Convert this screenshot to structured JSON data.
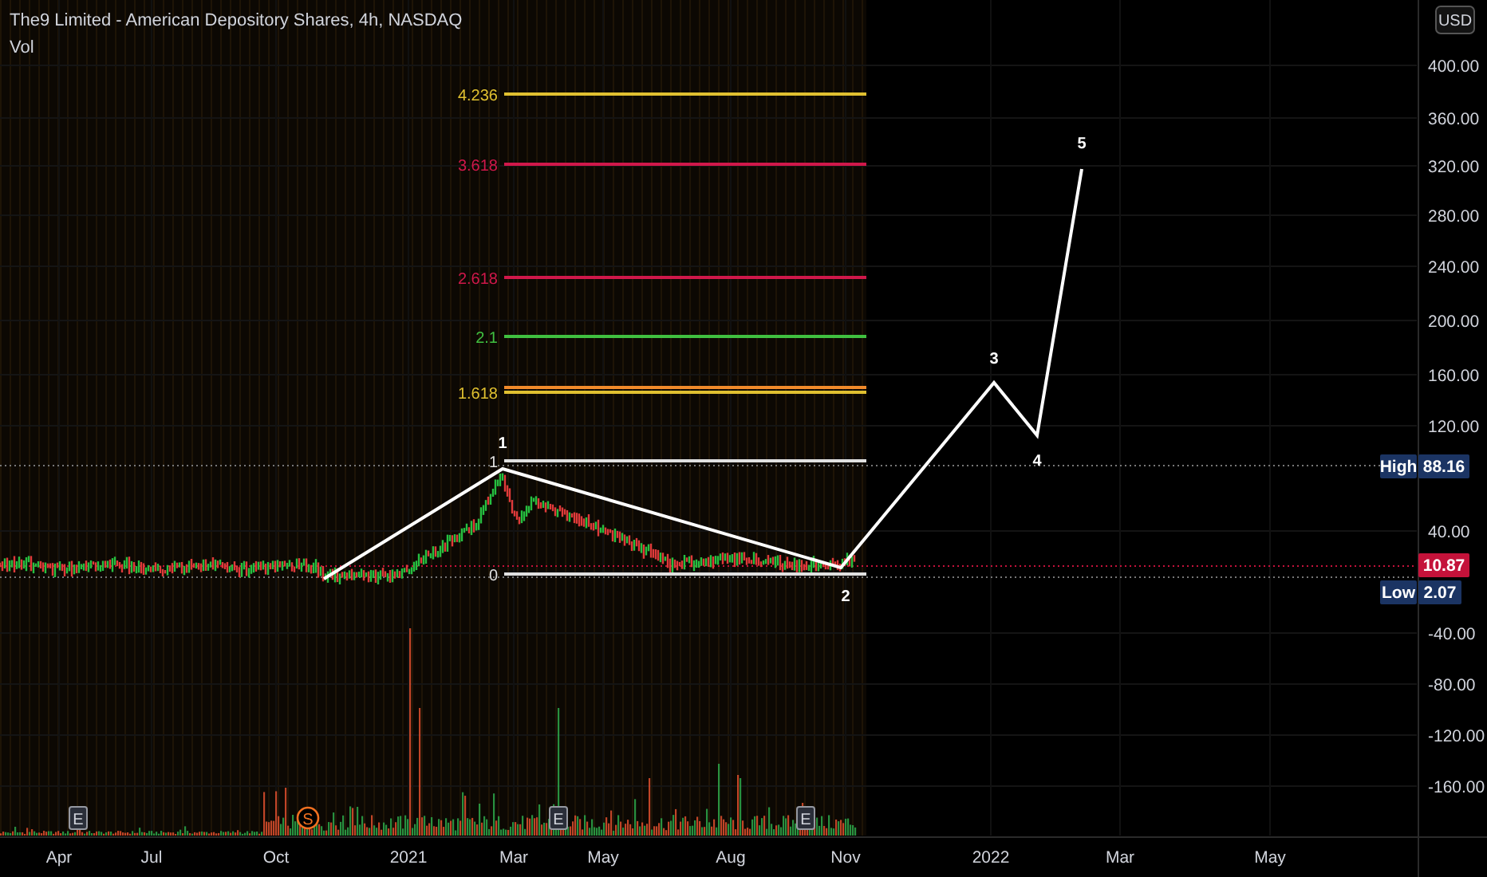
{
  "header": {
    "title": "The9 Limited - American Depository Shares, 4h, NASDAQ",
    "indicator": "Vol"
  },
  "currency_button": "USD",
  "price_axis": {
    "ticks": [
      "400.00",
      "360.00",
      "320.00",
      "280.00",
      "240.00",
      "200.00",
      "160.00",
      "120.00",
      "40.00",
      "-40.00",
      "-80.00",
      "-120.00",
      "-160.00"
    ]
  },
  "time_axis": {
    "labels": [
      "Apr",
      "Jul",
      "Oct",
      "2021",
      "Mar",
      "May",
      "Aug",
      "Nov",
      "2022",
      "Mar",
      "May"
    ]
  },
  "price_markers": [
    {
      "kind": "high",
      "label": "High",
      "value": "88.16"
    },
    {
      "kind": "last",
      "value": "10.87"
    },
    {
      "kind": "low",
      "label": "Low",
      "value": "2.07"
    }
  ],
  "fib_levels": [
    {
      "label": "4.236",
      "color": "#e0c030"
    },
    {
      "label": "3.618",
      "color": "#d0184a"
    },
    {
      "label": "2.618",
      "color": "#d0184a"
    },
    {
      "label": "2.1",
      "color": "#40c040"
    },
    {
      "color": "#f08a2a"
    },
    {
      "label": "1.618",
      "color": "#e0c030"
    },
    {
      "label": "1",
      "color": "#e0e0e0"
    },
    {
      "label": "0",
      "color": "#e0e0e0"
    }
  ],
  "wave_labels": [
    "1",
    "2",
    "3",
    "4",
    "5"
  ],
  "events": [
    {
      "kind": "earnings",
      "label": "E"
    },
    {
      "kind": "split",
      "label": "S"
    },
    {
      "kind": "earnings",
      "label": "E"
    },
    {
      "kind": "earnings",
      "label": "E"
    }
  ]
}
